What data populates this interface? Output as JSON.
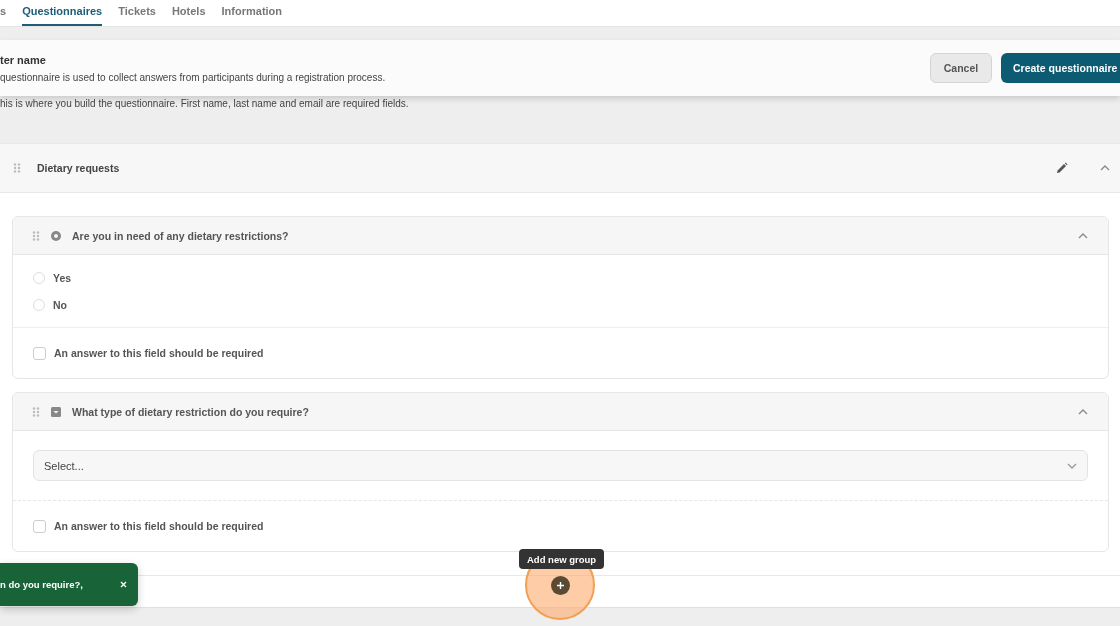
{
  "tabs": [
    {
      "label": "s",
      "selected": false
    },
    {
      "label": "Questionnaires",
      "selected": true
    },
    {
      "label": "Tickets",
      "selected": false
    },
    {
      "label": "Hotels",
      "selected": false
    },
    {
      "label": "Information",
      "selected": false
    }
  ],
  "header": {
    "title": "ter name",
    "description": "questionnaire is used to collect answers from participants during a registration process.",
    "buttons": [
      {
        "label": "Cancel",
        "kind": "secondary"
      },
      {
        "label": "Create questionnaire",
        "kind": "primary"
      }
    ]
  },
  "intro": "his is where you build the questionnaire. First name, last name and email are required fields.",
  "group": {
    "title": "Dietary requests",
    "expanded": true,
    "questions": [
      {
        "kind": "radio",
        "title": "Are you in need of any dietary restrictions?",
        "expanded": true,
        "options": [
          {
            "label": "Yes",
            "selected": false
          },
          {
            "label": "No",
            "selected": false
          }
        ],
        "required": {
          "label": "An answer to this field should be required",
          "checked": false
        }
      },
      {
        "kind": "select",
        "title": "What type of dietary restriction do you require?",
        "expanded": true,
        "placeholder": "Select...",
        "required": {
          "label": "An answer to this field should be required",
          "checked": false
        }
      }
    ]
  },
  "add_group": {
    "tooltip": "Add new group"
  },
  "toast": {
    "message": "n do you require?,"
  }
}
